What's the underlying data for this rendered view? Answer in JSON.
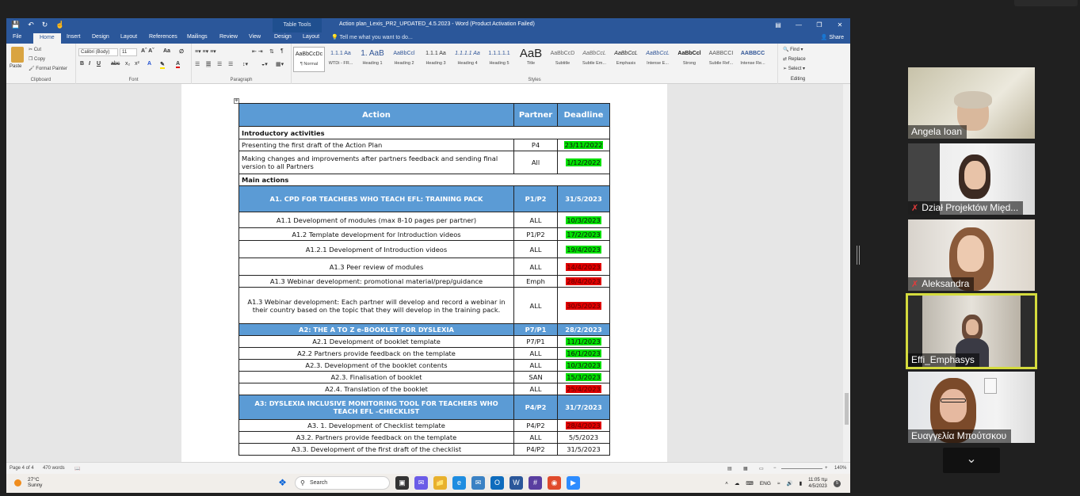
{
  "window": {
    "title": "Action plan_Lexis_PR2_UPDATED_4.5.2023 - Word (Product Activation Failed)",
    "table_tools": "Table Tools",
    "tabs": [
      "File",
      "Home",
      "Insert",
      "Design",
      "Layout",
      "References",
      "Mailings",
      "Review",
      "View",
      "Design",
      "Layout"
    ],
    "active_tab": "Home",
    "tell_me": "Tell me what you want to do...",
    "share": "Share"
  },
  "ribbon": {
    "clipboard": {
      "paste": "Paste",
      "cut": "Cut",
      "copy": "Copy",
      "format_painter": "Format Painter",
      "label": "Clipboard"
    },
    "font": {
      "family": "Calibri (Body)",
      "size": "11",
      "label": "Font"
    },
    "paragraph": {
      "label": "Paragraph"
    },
    "styles_label": "Styles",
    "styles": [
      {
        "preview": "AaBbCcDc",
        "name": "¶ Normal"
      },
      {
        "preview": "1.1.1 Aa",
        "name": "WTDi - FR..."
      },
      {
        "preview": "1. AaB",
        "name": "Heading 1"
      },
      {
        "preview": "AaBbCcl",
        "name": "Heading 2"
      },
      {
        "preview": "1.1.1 Aa",
        "name": "Heading 3"
      },
      {
        "preview": "1.1.1.1 Aa",
        "name": "Heading 4"
      },
      {
        "preview": "1.1.1.1.1",
        "name": "Heading 5"
      },
      {
        "preview": "AaB",
        "name": "Title"
      },
      {
        "preview": "AaBbCcD",
        "name": "Subtitle"
      },
      {
        "preview": "AaBbCcL",
        "name": "Subtle Em..."
      },
      {
        "preview": "AaBbCcL",
        "name": "Emphasis"
      },
      {
        "preview": "AaBbCcL",
        "name": "Intense E..."
      },
      {
        "preview": "AaBbCcl",
        "name": "Strong"
      },
      {
        "preview": "AABBCCI",
        "name": "Subtle Ref..."
      },
      {
        "preview": "AABBCC",
        "name": "Intense Re..."
      }
    ],
    "editing": {
      "find": "Find",
      "replace": "Replace",
      "select": "Select",
      "label": "Editing"
    }
  },
  "table": {
    "headers": {
      "action": "Action",
      "partner": "Partner",
      "deadline": "Deadline"
    },
    "intro_label": "Introductory activities",
    "intro_rows": [
      {
        "action": "Presenting the first draft of the Action Plan",
        "partner": "P4",
        "deadline": "23/11/2022",
        "hl": "g"
      },
      {
        "action": "Making changes and improvements after partners feedback and sending final version to all Partners",
        "partner": "All",
        "deadline": "1/12/2022",
        "hl": "g"
      }
    ],
    "main_label": "Main actions",
    "a1": {
      "action": "A1. CPD FOR TEACHERS WHO TEACH EFL: TRAINING PACK",
      "partner": "P1/P2",
      "deadline": "31/5/2023"
    },
    "a1_rows": [
      {
        "action": "A1.1 Development of modules (max 8-10 pages per partner)",
        "partner": "ALL",
        "deadline": "10/3/2023",
        "hl": "g"
      },
      {
        "action": "A1.2 Template development for Introduction videos",
        "partner": "P1/P2",
        "deadline": "17/2/2023",
        "hl": "g"
      },
      {
        "action": "A1.2.1 Development of Introduction videos",
        "partner": "ALL",
        "deadline": "19/4/2023",
        "hl": "g"
      },
      {
        "action": "A1.3 Peer review of modules",
        "partner": "ALL",
        "deadline": "14/4/2023",
        "hl": "r"
      },
      {
        "action": "A1.3 Webinar development: promotional material/prep/guidance",
        "partner": "Emph",
        "deadline": "28/4/2023",
        "hl": "r"
      },
      {
        "action": "A1.3 Webinar development: Each partner will develop and record a webinar in their country based on the topic that they will develop in the training pack.",
        "partner": "ALL",
        "deadline": "30/5/2023",
        "hl": "r"
      }
    ],
    "a2": {
      "action": "A2: THE A TO Z e-BOOKLET FOR DYSLEXIA",
      "partner": "P7/P1",
      "deadline": "28/2/2023"
    },
    "a2_rows": [
      {
        "action": "A2.1 Development of booklet template",
        "partner": "P7/P1",
        "deadline": "11/1/2023",
        "hl": "g"
      },
      {
        "action": "A2.2 Partners provide feedback on the template",
        "partner": "ALL",
        "deadline": "16/1/2023",
        "hl": "g"
      },
      {
        "action": "A2.3. Development of the booklet contents",
        "partner": "ALL",
        "deadline": "10/3/2023",
        "hl": "g"
      },
      {
        "action": "A2.3. Finalisation of booklet",
        "partner": "SAN",
        "deadline": "15/3/2023",
        "hl": "g"
      },
      {
        "action": "A2.4. Translation of the booklet",
        "partner": "ALL",
        "deadline": "25/4/2023",
        "hl": "r"
      }
    ],
    "a3": {
      "action": "A3: DYSLEXIA INCLUSIVE MONITORING TOOL FOR TEACHERS WHO TEACH EFL –CHECKLIST",
      "partner": "P4/P2",
      "deadline": "31/7/2023"
    },
    "a3_rows": [
      {
        "action": "A3. 1. Development of Checklist template",
        "partner": "P4/P2",
        "deadline": "28/4/2023",
        "hl": "r"
      },
      {
        "action": "A3.2. Partners provide feedback on the template",
        "partner": "ALL",
        "deadline": "5/5/2023",
        "hl": ""
      },
      {
        "action": "A3.3. Development of the first draft of the checklist",
        "partner": "P4/P2",
        "deadline": "31/5/2023",
        "hl": ""
      }
    ]
  },
  "status_bar": {
    "page": "Page 4 of 4",
    "words": "470 words",
    "zoom": "140%"
  },
  "taskbar": {
    "temp": "27°C",
    "weather": "Sunny",
    "search": "Search",
    "lang": "ENG",
    "time": "11:05 πμ",
    "date": "4/5/2023"
  },
  "participants": [
    {
      "name": "Angela Ioan",
      "muted": false,
      "active": false
    },
    {
      "name": "Dział Projektów Międ...",
      "muted": true,
      "active": false
    },
    {
      "name": "Aleksandra",
      "muted": true,
      "active": false
    },
    {
      "name": "Effi_Emphasys",
      "muted": false,
      "active": true
    },
    {
      "name": "Ευαγγελία Μπούτσκου",
      "muted": false,
      "active": false
    }
  ]
}
